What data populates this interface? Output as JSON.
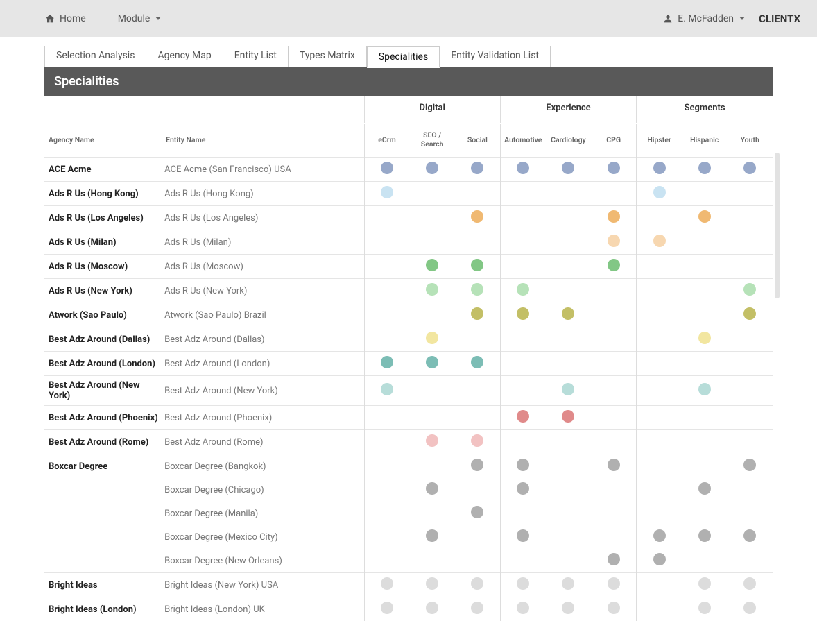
{
  "topbar": {
    "home": "Home",
    "module": "Module",
    "user": "E. McFadden",
    "brand": "CLIENTX"
  },
  "tabs": [
    {
      "label": "Selection Analysis",
      "active": false
    },
    {
      "label": "Agency Map",
      "active": false
    },
    {
      "label": "Entity List",
      "active": false
    },
    {
      "label": "Types Matrix",
      "active": false
    },
    {
      "label": "Specialities",
      "active": true
    },
    {
      "label": "Entity Validation List",
      "active": false
    }
  ],
  "section_title": "Specialities",
  "columns": {
    "agency_header": "Agency Name",
    "entity_header": "Entity Name",
    "groups": [
      {
        "label": "Digital",
        "subs": [
          "eCrm",
          "SEO / Search",
          "Social"
        ]
      },
      {
        "label": "Experience",
        "subs": [
          "Automotive",
          "Cardiology",
          "CPG"
        ]
      },
      {
        "label": "Segments",
        "subs": [
          "Hipster",
          "Hispanic",
          "Youth"
        ]
      }
    ]
  },
  "colors": {
    "blue": "#97a8c9",
    "lblue": "#c9e3f2",
    "orange": "#f0b972",
    "lorange": "#f7d7b0",
    "green": "#82c785",
    "lgreen": "#b6e2b8",
    "olive": "#c3bf66",
    "lyellow": "#f2e6a0",
    "teal": "#7cbdb5",
    "lteal": "#b7ddd9",
    "red": "#e08a8a",
    "lred": "#f2c2c2",
    "gray": "#b0b0b0",
    "lgray": "#dcdcdc"
  },
  "rows": [
    {
      "agency": "ACE Acme",
      "entity": "ACE Acme (San Francisco) USA",
      "dots": {
        "0": "blue",
        "1": "blue",
        "2": "blue",
        "3": "blue",
        "4": "blue",
        "5": "blue",
        "6": "blue",
        "7": "blue",
        "8": "blue"
      }
    },
    {
      "agency": "Ads R Us (Hong Kong)",
      "entity": "Ads R Us (Hong Kong)",
      "dots": {
        "0": "lblue",
        "6": "lblue"
      }
    },
    {
      "agency": "Ads R Us (Los Angeles)",
      "entity": "Ads R Us (Los Angeles)",
      "dots": {
        "2": "orange",
        "5": "orange",
        "7": "orange"
      }
    },
    {
      "agency": "Ads R Us (Milan)",
      "entity": "Ads R Us (Milan)",
      "dots": {
        "5": "lorange",
        "6": "lorange"
      }
    },
    {
      "agency": "Ads R Us (Moscow)",
      "entity": "Ads R Us (Moscow)",
      "dots": {
        "1": "green",
        "2": "green",
        "5": "green"
      }
    },
    {
      "agency": "Ads R Us (New York)",
      "entity": "Ads R Us (New York)",
      "dots": {
        "1": "lgreen",
        "2": "lgreen",
        "3": "lgreen",
        "8": "lgreen"
      }
    },
    {
      "agency": "Atwork (Sao Paulo)",
      "entity": "Atwork (Sao Paulo) Brazil",
      "dots": {
        "2": "olive",
        "3": "olive",
        "4": "olive",
        "8": "olive"
      }
    },
    {
      "agency": "Best Adz Around (Dallas)",
      "entity": "Best Adz Around (Dallas)",
      "dots": {
        "1": "lyellow",
        "7": "lyellow"
      }
    },
    {
      "agency": "Best Adz Around (London)",
      "entity": "Best Adz Around (London)",
      "dots": {
        "0": "teal",
        "1": "teal",
        "2": "teal"
      }
    },
    {
      "agency": "Best Adz Around (New York)",
      "entity": "Best Adz Around (New York)",
      "dots": {
        "0": "lteal",
        "4": "lteal",
        "7": "lteal"
      }
    },
    {
      "agency": "Best Adz Around (Phoenix)",
      "entity": "Best Adz Around (Phoenix)",
      "dots": {
        "3": "red",
        "4": "red"
      }
    },
    {
      "agency": "Best Adz Around (Rome)",
      "entity": "Best Adz Around (Rome)",
      "dots": {
        "1": "lred",
        "2": "lred"
      }
    },
    {
      "agency": "Boxcar Degree",
      "entity": "Boxcar Degree (Bangkok)",
      "dots": {
        "2": "gray",
        "3": "gray",
        "5": "gray",
        "8": "gray"
      }
    },
    {
      "agency": "",
      "entity": "Boxcar Degree (Chicago)",
      "noTop": true,
      "dots": {
        "1": "gray",
        "3": "gray",
        "7": "gray"
      }
    },
    {
      "agency": "",
      "entity": "Boxcar Degree (Manila)",
      "noTop": true,
      "dots": {
        "2": "gray"
      }
    },
    {
      "agency": "",
      "entity": "Boxcar Degree (Mexico City)",
      "noTop": true,
      "dots": {
        "1": "gray",
        "3": "gray",
        "6": "gray",
        "7": "gray",
        "8": "gray"
      }
    },
    {
      "agency": "",
      "entity": "Boxcar Degree (New Orleans)",
      "noTop": true,
      "dots": {
        "5": "gray",
        "6": "gray"
      }
    },
    {
      "agency": "Bright Ideas",
      "entity": "Bright Ideas (New York) USA",
      "dots": {
        "0": "lgray",
        "1": "lgray",
        "2": "lgray",
        "3": "lgray",
        "4": "lgray",
        "5": "lgray",
        "7": "lgray",
        "8": "lgray"
      }
    },
    {
      "agency": "Bright Ideas (London)",
      "entity": "Bright Ideas (London) UK",
      "dots": {
        "0": "lgray",
        "1": "lgray",
        "2": "lgray",
        "3": "lgray",
        "4": "lgray",
        "5": "lgray",
        "7": "lgray",
        "8": "lgray"
      }
    }
  ]
}
